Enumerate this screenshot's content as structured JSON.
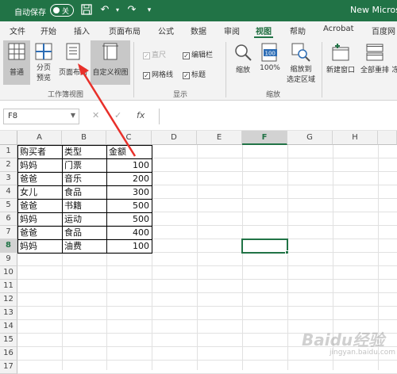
{
  "titlebar": {
    "autosave_label": "自动保存",
    "toggle_state": "关",
    "document_title": "New Microso"
  },
  "tabs": [
    "文件",
    "开始",
    "插入",
    "页面布局",
    "公式",
    "数据",
    "审阅",
    "视图",
    "帮助",
    "Acrobat",
    "百度网"
  ],
  "active_tab": "视图",
  "ribbon": {
    "workbook_views": {
      "normal": "普通",
      "page_break_line1": "分页",
      "page_break_line2": "预览",
      "page_layout": "页面布局",
      "custom_views": "自定义视图",
      "group_label": "工作簿视图"
    },
    "show": {
      "ruler": "直尺",
      "formula_bar": "编辑栏",
      "gridlines": "网格线",
      "headings": "标题",
      "group_label": "显示"
    },
    "zoom": {
      "zoom": "缩放",
      "zoom_100": "100%",
      "zoom_100_icon_text": "100",
      "zoom_selection_line1": "缩放到",
      "zoom_selection_line2": "选定区域",
      "group_label": "缩放"
    },
    "window": {
      "new_window": "新建窗口",
      "arrange_all": "全部重排",
      "freeze": "冻"
    }
  },
  "formula_bar": {
    "name_box": "F8",
    "fx": "fx",
    "cancel": "✕",
    "enter": "✓",
    "content": ""
  },
  "sheet": {
    "columns": [
      "A",
      "B",
      "C",
      "D",
      "E",
      "F",
      "G",
      "H"
    ],
    "selected_column": "F",
    "rows": [
      "1",
      "2",
      "3",
      "4",
      "5",
      "6",
      "7",
      "8",
      "9",
      "10",
      "11",
      "12",
      "13",
      "14",
      "15",
      "16",
      "17"
    ],
    "selected_row": "8",
    "data": [
      [
        "购买者",
        "类型",
        "金额"
      ],
      [
        "妈妈",
        "门票",
        "100"
      ],
      [
        "爸爸",
        "音乐",
        "200"
      ],
      [
        "女儿",
        "食品",
        "300"
      ],
      [
        "爸爸",
        "书籍",
        "500"
      ],
      [
        "妈妈",
        "运动",
        "500"
      ],
      [
        "爸爸",
        "食品",
        "400"
      ],
      [
        "妈妈",
        "油费",
        "100"
      ]
    ]
  },
  "watermark": {
    "text": "Baidu经验",
    "sub": "jingyan.baidu.com"
  },
  "colors": {
    "accent": "#217346",
    "arrow": "#e8302a"
  }
}
